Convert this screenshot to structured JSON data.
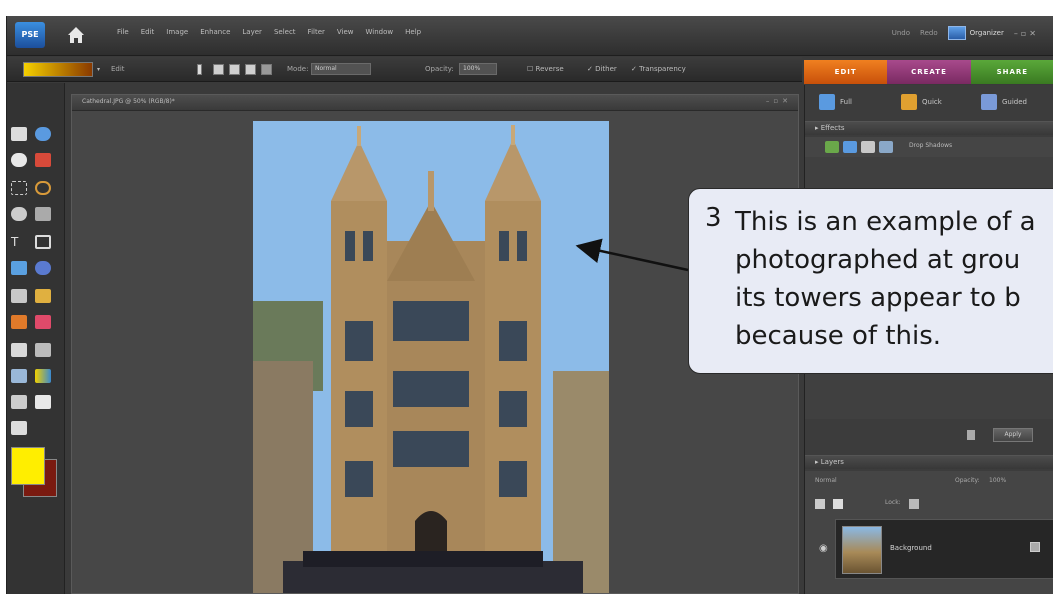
{
  "app": {
    "logo_text": "PSE",
    "menu": [
      "File",
      "Edit",
      "Image",
      "Enhance",
      "Layer",
      "Select",
      "Filter",
      "View",
      "Window",
      "Help"
    ],
    "menu_right": [
      "Undo",
      "Redo"
    ],
    "organizer_label": "Organizer"
  },
  "options_bar": {
    "mode_label": "Mode:",
    "mode_value": "Normal",
    "opacity_label": "Opacity:",
    "opacity_value": "100%",
    "reverse_label": "Reverse",
    "dither_label": "Dither",
    "transparency_label": "Transparency"
  },
  "mode_tabs": [
    "EDIT",
    "CREATE",
    "SHARE"
  ],
  "document": {
    "title": "Cathedral.JPG @ 50% (RGB/8)*"
  },
  "colors": {
    "foreground": "#ffee00",
    "background": "#7a1a10",
    "edit_tab": "#e06a14",
    "create_tab": "#94407c",
    "share_tab": "#4c9630"
  },
  "panels": {
    "subtabs": [
      "Full",
      "Quick",
      "Guided"
    ],
    "effects_label": "Effects",
    "effects_dropdown": "Drop Shadows",
    "apply_label": "Apply",
    "layers_label": "Layers",
    "blend_mode": "Normal",
    "opacity_label": "Opacity:",
    "opacity_value": "100%",
    "lock_label": "Lock:",
    "layer_name": "Background"
  },
  "callout": {
    "number": "3",
    "text": "This is an example of a\nphotographed at grou\nits towers appear to b\nbecause of this."
  }
}
